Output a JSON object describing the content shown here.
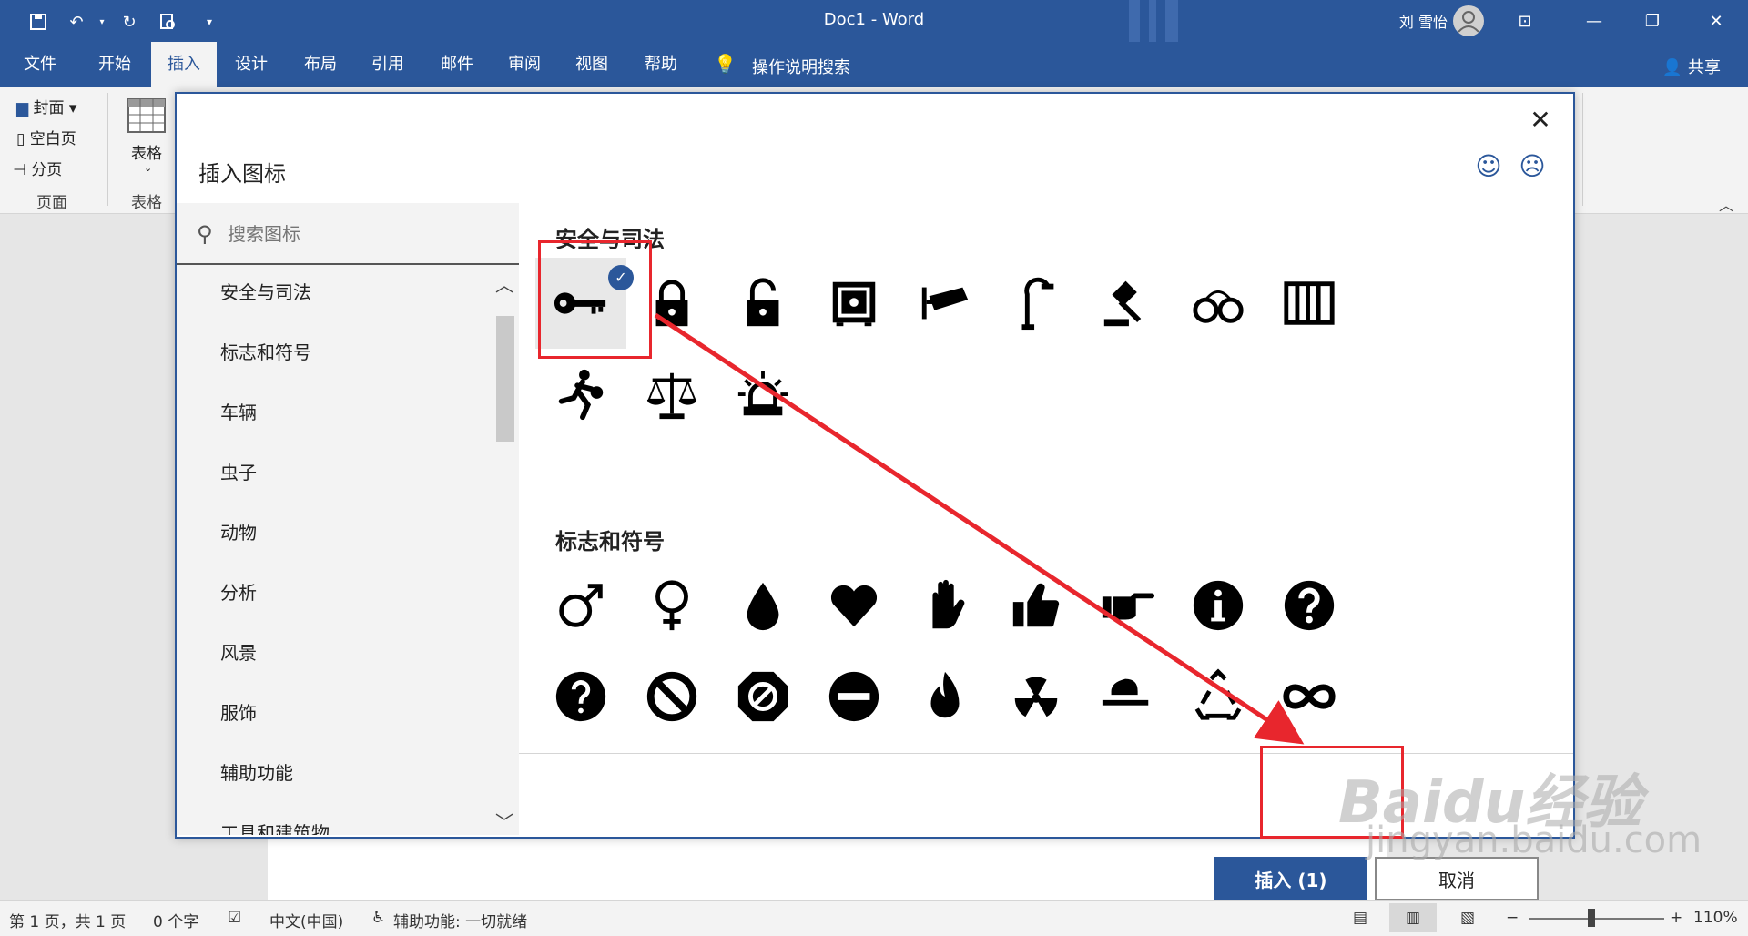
{
  "app": {
    "title": "Doc1  -  Word",
    "user": "刘 雪怡",
    "share": "共享"
  },
  "tabs": [
    "文件",
    "开始",
    "插入",
    "设计",
    "布局",
    "引用",
    "邮件",
    "审阅",
    "视图",
    "帮助"
  ],
  "active_tab": "插入",
  "tell_me": "操作说明搜索",
  "ribbon": {
    "pages": {
      "cover": "封面",
      "blank": "空白页",
      "break": "分页",
      "group": "页面"
    },
    "table": {
      "label": "表格",
      "group": "表格"
    }
  },
  "dialog": {
    "title": "插入图标",
    "search_placeholder": "搜索图标",
    "categories": [
      "安全与司法",
      "标志和符号",
      "车辆",
      "虫子",
      "动物",
      "分析",
      "风景",
      "服饰",
      "辅助功能",
      "工具和建筑物"
    ],
    "sections": [
      {
        "title": "安全与司法",
        "icons": [
          "key-icon",
          "lock-closed-icon",
          "lock-open-icon",
          "safe-icon",
          "security-camera-icon",
          "street-light-icon",
          "gavel-icon",
          "handcuffs-icon",
          "jail-icon",
          "running-thief-icon",
          "scales-icon",
          "siren-icon"
        ]
      },
      {
        "title": "标志和符号",
        "icons": [
          "male-icon",
          "female-icon",
          "drop-icon",
          "heart-icon",
          "hand-icon",
          "thumbs-up-icon",
          "pointing-hand-icon",
          "info-icon",
          "question-icon",
          "help-icon",
          "prohibited-icon",
          "stop-icon",
          "minus-icon",
          "fire-icon",
          "radiation-icon",
          "hazard-icon",
          "recycle-icon",
          "infinity-icon"
        ]
      }
    ],
    "insert_label": "插入 (1)",
    "cancel_label": "取消"
  },
  "status": {
    "page": "第 1 页，共 1 页",
    "words": "0 个字",
    "language": "中文(中国)",
    "accessibility": "辅助功能: 一切就绪",
    "zoom": "110%"
  },
  "watermark": {
    "brand": "Baidu经验",
    "url": "jingyan.baidu.com"
  },
  "colors": {
    "accent": "#2b579a",
    "annotation": "#e8262d"
  }
}
